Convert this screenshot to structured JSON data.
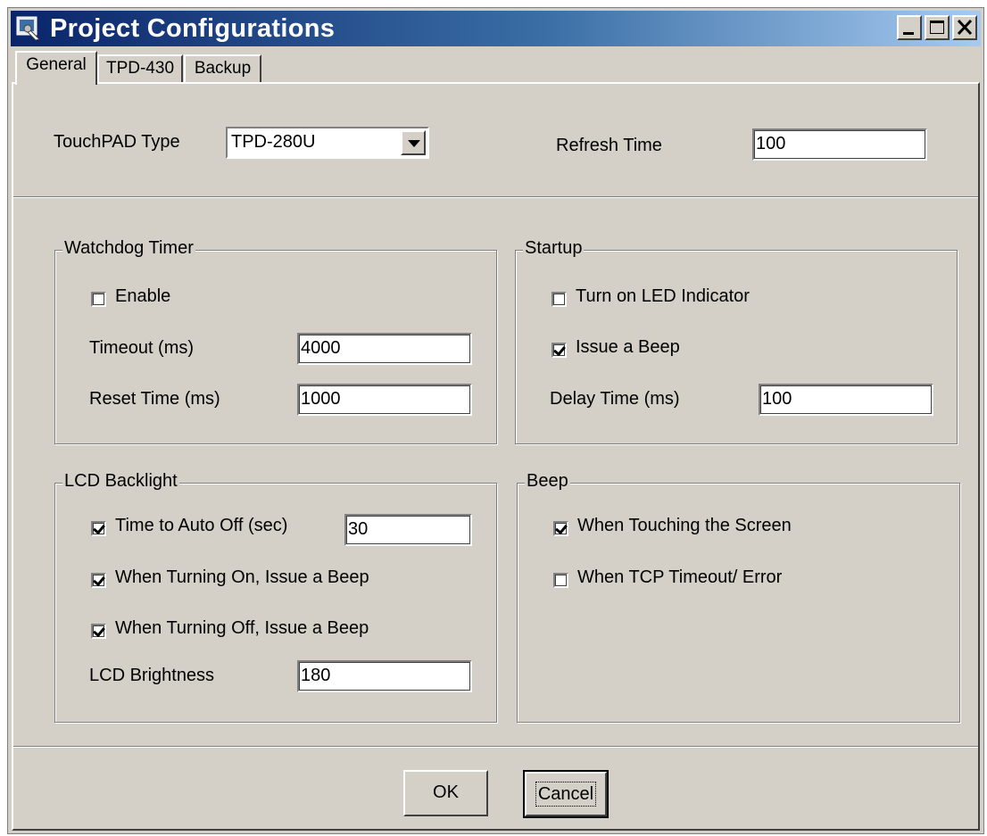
{
  "window": {
    "title": "Project Configurations",
    "minimize_label": "_",
    "maximize_label": "☐",
    "close_label": "✕"
  },
  "tabs": [
    {
      "label": "General",
      "active": true
    },
    {
      "label": "TPD-430",
      "active": false
    },
    {
      "label": "Backup",
      "active": false
    }
  ],
  "general": {
    "touchpad_type_label": "TouchPAD Type",
    "touchpad_type_value": "TPD-280U",
    "refresh_time_label": "Refresh Time",
    "refresh_time_value": "100"
  },
  "watchdog": {
    "legend": "Watchdog Timer",
    "enable_label": "Enable",
    "enable_checked": false,
    "timeout_label": "Timeout (ms)",
    "timeout_value": "4000",
    "reset_label": "Reset Time (ms)",
    "reset_value": "1000"
  },
  "startup": {
    "legend": "Startup",
    "led_label": "Turn on LED Indicator",
    "led_checked": false,
    "beep_label": "Issue a Beep",
    "beep_checked": true,
    "delay_label": "Delay Time (ms)",
    "delay_value": "100"
  },
  "lcd": {
    "legend": "LCD Backlight",
    "auto_off_label": "Time to Auto Off (sec)",
    "auto_off_checked": true,
    "auto_off_value": "30",
    "on_beep_label": "When Turning On, Issue a Beep",
    "on_beep_checked": true,
    "off_beep_label": "When Turning Off, Issue a Beep",
    "off_beep_checked": true,
    "brightness_label": "LCD Brightness",
    "brightness_value": "180"
  },
  "beep": {
    "legend": "Beep",
    "touch_label": "When Touching the Screen",
    "touch_checked": true,
    "tcp_label": "When TCP Timeout/ Error",
    "tcp_checked": false
  },
  "buttons": {
    "ok_label": "OK",
    "cancel_label": "Cancel"
  }
}
